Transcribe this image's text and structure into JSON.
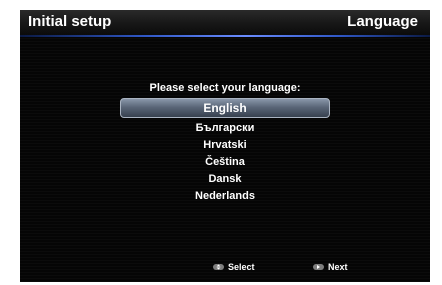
{
  "header": {
    "title": "Initial setup",
    "section": "Language"
  },
  "prompt": "Please select your language:",
  "languages": {
    "selected_index": 0,
    "items": [
      {
        "label": "English"
      },
      {
        "label": "Български"
      },
      {
        "label": "Hrvatski"
      },
      {
        "label": "Čeština"
      },
      {
        "label": "Dansk"
      },
      {
        "label": "Nederlands"
      }
    ]
  },
  "hints": {
    "select": {
      "icon": "up-down-arrows-icon",
      "label": "Select"
    },
    "next": {
      "icon": "right-arrow-icon",
      "label": "Next"
    }
  },
  "colors": {
    "background": "#000000",
    "accent_rule": "#2f57c6",
    "selection": "#5a6678",
    "text": "#ffffff"
  }
}
